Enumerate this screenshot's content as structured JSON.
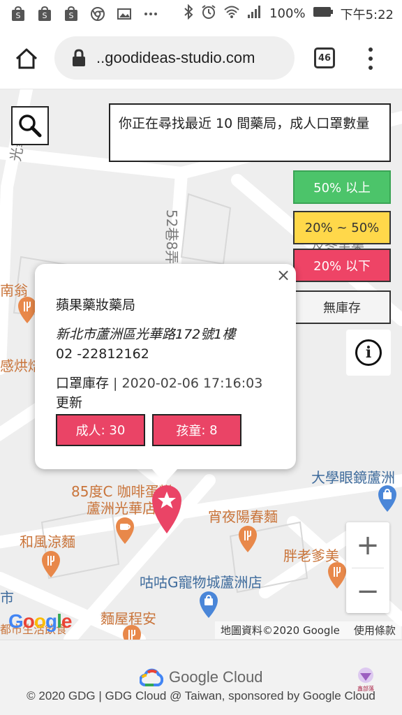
{
  "status_bar": {
    "battery": "100%",
    "time": "下午5:22"
  },
  "browser": {
    "url": "..goodideas-studio.com",
    "tabs_count": "46"
  },
  "search": {
    "info_text": "你正在尋找最近 10 間藥局，成人口罩數量"
  },
  "legend": {
    "above_50": "50% 以上",
    "between": "20% ~ 50%",
    "below_20": "20% 以下",
    "none": "無庫存"
  },
  "about": {
    "symbol": "i"
  },
  "popup": {
    "close": "×",
    "name": "蘋果藥妝藥局",
    "address": "新北市蘆洲區光華路172號1樓",
    "phone": "02 -22812162",
    "stock_label": "口罩庫存",
    "stock_sep": " | ",
    "stock_time": "2020-02-06 17:16:03",
    "stock_suffix": "更新",
    "adult_label": "成人",
    "adult_value": ": 30",
    "child_label": "孩童",
    "child_value": ": 8"
  },
  "map_labels": {
    "road1": "光華路",
    "road2": "52巷8弄",
    "nanweng": "南翁",
    "shop1": "感烘焙",
    "cafe1": "85度C 咖啡蛋糕",
    "cafe2": "蘆洲光華店",
    "eyeglass": "大學眼鏡蘆洲",
    "noodle": "宵夜陽春麵",
    "liangmian": "和風涼麵",
    "panlao": "胖老爹美",
    "pet": "咕咕G寵物城蘆洲店",
    "city": "市",
    "noodle2": "麵屋程安",
    "jiaxiang": "及冬里集",
    "dujia": "都市生活飲食"
  },
  "map_controls": {
    "zoom_in": "+",
    "zoom_out": "−",
    "google": "Google",
    "attribution": "地圖資料©2020 Google",
    "terms": "使用條款"
  },
  "footer": {
    "brand": "Google Cloud",
    "copyright": "© 2020 GDG | GDG Cloud @ Taiwan, sponsored by Google Cloud",
    "badge": "鑫部落"
  },
  "colors": {
    "green": "#4cc46a",
    "yellow": "#ffd84a",
    "red": "#ea4466",
    "orange_label": "#c9743a",
    "blue_label": "#3e6b9c"
  },
  "icons": [
    "shop-bag-icon",
    "image-icon",
    "chrome-icon",
    "bluetooth-icon",
    "alarm-icon",
    "wifi-icon",
    "signal-icon",
    "battery-icon",
    "home-icon",
    "lock-icon",
    "search-icon",
    "info-icon",
    "restaurant-icon",
    "cafe-icon",
    "shopping-icon",
    "star-marker-icon"
  ]
}
